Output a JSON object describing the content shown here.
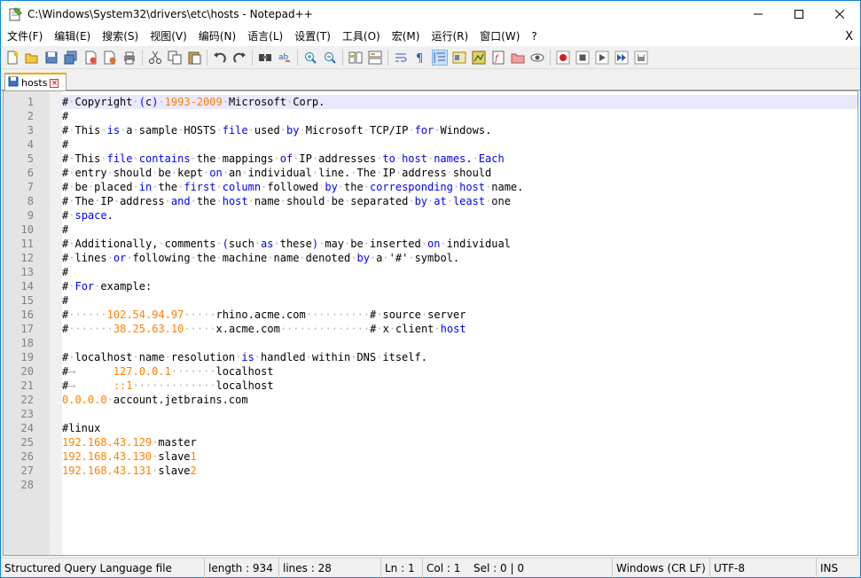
{
  "window": {
    "title": "C:\\Windows\\System32\\drivers\\etc\\hosts - Notepad++"
  },
  "menu": [
    "文件(F)",
    "编辑(E)",
    "搜索(S)",
    "视图(V)",
    "编码(N)",
    "语言(L)",
    "设置(T)",
    "工具(O)",
    "宏(M)",
    "运行(R)",
    "窗口(W)",
    "?"
  ],
  "menu_close": "X",
  "tab": {
    "label": "hosts"
  },
  "editor": {
    "lines": [
      {
        "n": "1",
        "t": "# Copyright (c) 1993-2009 Microsoft Corp."
      },
      {
        "n": "2",
        "t": "#"
      },
      {
        "n": "3",
        "t": "# This is a sample HOSTS file used by Microsoft TCP/IP for Windows."
      },
      {
        "n": "4",
        "t": "#"
      },
      {
        "n": "5",
        "t": "# This file contains the mappings of IP addresses to host names. Each"
      },
      {
        "n": "6",
        "t": "# entry should be kept on an individual line. The IP address should"
      },
      {
        "n": "7",
        "t": "# be placed in the first column followed by the corresponding host name."
      },
      {
        "n": "8",
        "t": "# The IP address and the host name should be separated by at least one"
      },
      {
        "n": "9",
        "t": "# space."
      },
      {
        "n": "10",
        "t": "#"
      },
      {
        "n": "11",
        "t": "# Additionally, comments (such as these) may be inserted on individual"
      },
      {
        "n": "12",
        "t": "# lines or following the machine name denoted by a '#' symbol."
      },
      {
        "n": "13",
        "t": "#"
      },
      {
        "n": "14",
        "t": "# For example:"
      },
      {
        "n": "15",
        "t": "#"
      },
      {
        "n": "16",
        "t": "#      102.54.94.97     rhino.acme.com          # source server"
      },
      {
        "n": "17",
        "t": "#       38.25.63.10     x.acme.com              # x client host"
      },
      {
        "n": "18",
        "t": ""
      },
      {
        "n": "19",
        "t": "# localhost name resolution is handled within DNS itself."
      },
      {
        "n": "20",
        "t": "#\t127.0.0.1       localhost"
      },
      {
        "n": "21",
        "t": "#\t::1             localhost"
      },
      {
        "n": "22",
        "t": "0.0.0.0 account.jetbrains.com"
      },
      {
        "n": "23",
        "t": ""
      },
      {
        "n": "24",
        "t": "#linux"
      },
      {
        "n": "25",
        "t": "192.168.43.129 master"
      },
      {
        "n": "26",
        "t": "192.168.43.130 slave1"
      },
      {
        "n": "27",
        "t": "192.168.43.131 slave2"
      },
      {
        "n": "28",
        "t": ""
      }
    ]
  },
  "status": {
    "language": "Structured Query Language file",
    "length": "length : 934",
    "lines": "lines : 28",
    "ln": "Ln : 1",
    "col": "Col : 1",
    "sel": "Sel : 0 | 0",
    "eol": "Windows (CR LF)",
    "encoding": "UTF-8",
    "mode": "INS"
  },
  "colors": {
    "comment": "#000000",
    "keyword": "#0000ff",
    "number": "#ff8000",
    "whitespace": "#b4b4b4",
    "tab_accent": "#f8a200"
  }
}
